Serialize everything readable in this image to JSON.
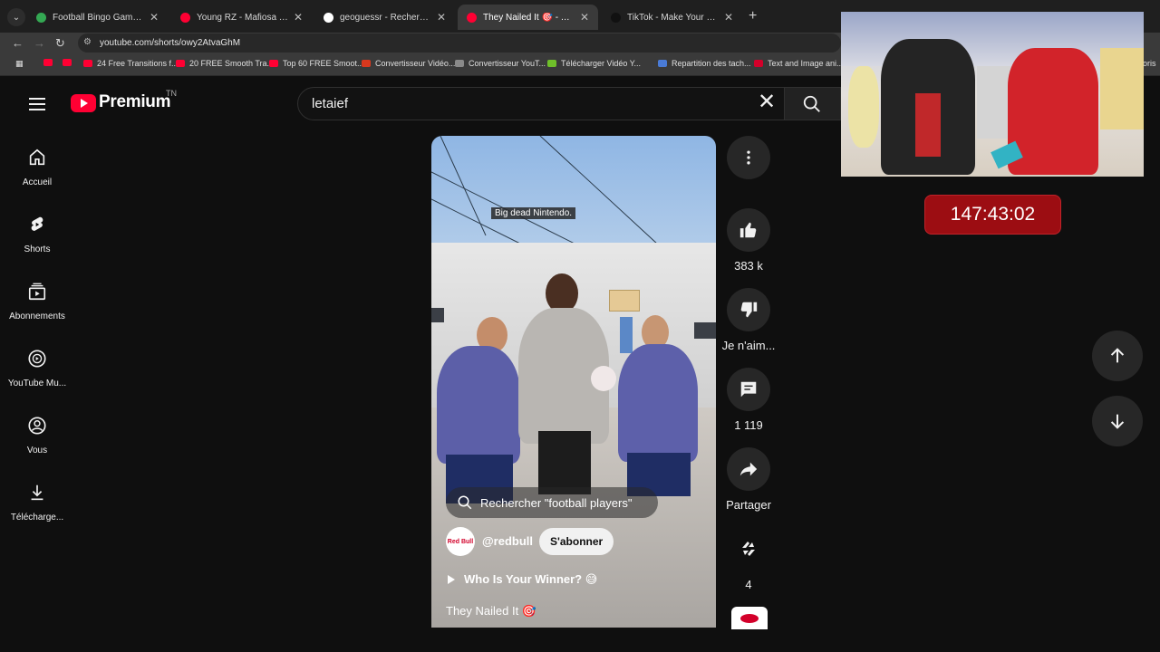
{
  "browser": {
    "tabs": [
      {
        "label": "Football Bingo Game - Play No",
        "fav": "#34a853",
        "active": false
      },
      {
        "label": "Young RZ - Mafiosa (Official M",
        "fav": "#ff0033",
        "active": false
      },
      {
        "label": "geoguessr - Recherche Google",
        "fav": "#ffffff",
        "active": false
      },
      {
        "label": "They Nailed It 🎯 - YouTube",
        "fav": "#ff0033",
        "active": true
      },
      {
        "label": "TikTok - Make Your Day",
        "fav": "#111111",
        "active": false
      }
    ],
    "url": "youtube.com/shorts/owy2AtvaGhM",
    "bookmarks": [
      "24 Free Transitions f...",
      "20 FREE Smooth Tra...",
      "Top 60 FREE Smoot...",
      "Convertisseur Vidéo...",
      "Convertisseur YouT...",
      "Télécharger Vidéo Y...",
      "Repartition des tach...",
      "Text and Image ani..."
    ],
    "bookmark_overflow": "roris"
  },
  "youtube": {
    "logo_text": "Premium",
    "region": "TN",
    "search_query": "letaief",
    "nav": [
      {
        "label": "Accueil",
        "icon": "home-icon"
      },
      {
        "label": "Shorts",
        "icon": "shorts-icon"
      },
      {
        "label": "Abonnements",
        "icon": "subscriptions-icon"
      },
      {
        "label": "YouTube Mu...",
        "icon": "youtube-music-icon"
      },
      {
        "label": "Vous",
        "icon": "account-icon"
      },
      {
        "label": "Télécharge...",
        "icon": "download-icon"
      }
    ],
    "short": {
      "caption": "Big dead Nintendo.",
      "search_suggestion": "Rechercher \"football players\"",
      "channel_logo": "Red Bull",
      "channel": "@redbull",
      "subscribe": "S'abonner",
      "playlist": "Who Is Your Winner? 😅",
      "title": "They Nailed It 🎯"
    },
    "actions": {
      "likes": "383 k",
      "dislike": "Je n'aim...",
      "comments": "1 119",
      "share": "Partager",
      "remix": "4"
    }
  },
  "overlay": {
    "timer": "147:43:02"
  }
}
